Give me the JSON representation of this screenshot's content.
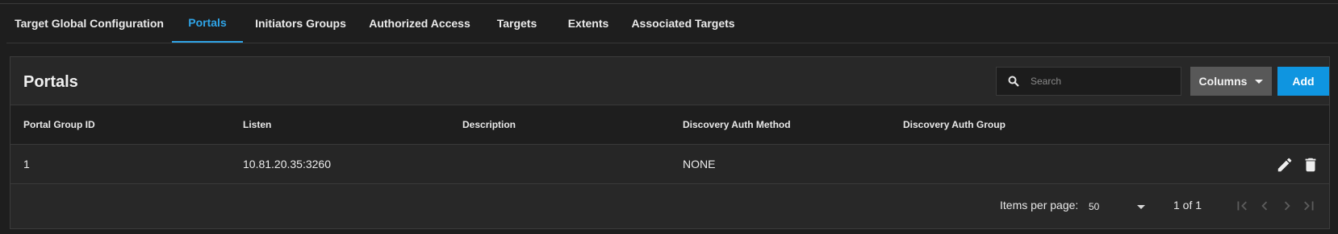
{
  "tabs": [
    {
      "label": "Target Global Configuration",
      "active": false
    },
    {
      "label": "Portals",
      "active": true
    },
    {
      "label": "Initiators Groups",
      "active": false
    },
    {
      "label": "Authorized Access",
      "active": false
    },
    {
      "label": "Targets",
      "active": false
    },
    {
      "label": "Extents",
      "active": false
    },
    {
      "label": "Associated Targets",
      "active": false
    }
  ],
  "card": {
    "title": "Portals",
    "search_placeholder": "Search",
    "columns_label": "Columns",
    "add_label": "Add"
  },
  "table": {
    "headers": [
      "Portal Group ID",
      "Listen",
      "Description",
      "Discovery Auth Method",
      "Discovery Auth Group"
    ],
    "rows": [
      {
        "portal_group_id": "1",
        "listen": "10.81.20.35:3260",
        "description": "",
        "discovery_auth_method": "NONE",
        "discovery_auth_group": ""
      }
    ]
  },
  "row_actions": [
    "edit-icon",
    "delete-icon"
  ],
  "paginator": {
    "items_per_page_label": "Items per page:",
    "page_size": "50",
    "range_label": "1 of 1"
  },
  "colors": {
    "accent": "#2fa4e7",
    "add_button": "#0f95e0",
    "columns_button": "#585858",
    "background": "#1e1e1e",
    "card": "#282828"
  }
}
